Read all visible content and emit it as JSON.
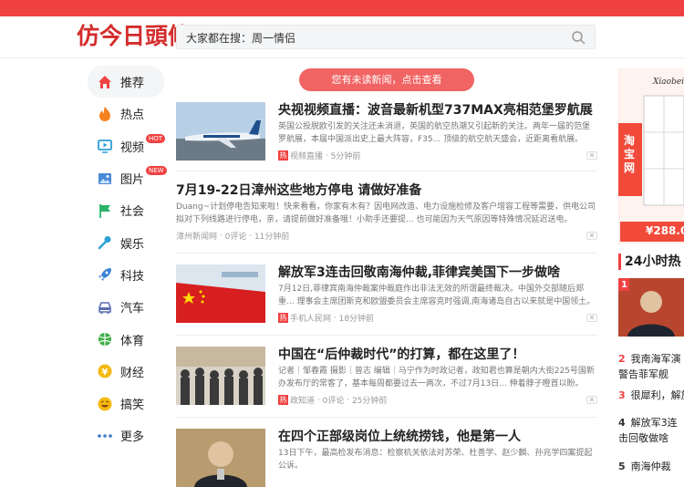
{
  "header": {
    "logo": "仿今日頭條",
    "search": {
      "placeholder": "大家都在搜：周一情侣",
      "value": "大家都在搜：周一情侣"
    }
  },
  "sidebar": {
    "items": [
      {
        "label": "推荐",
        "icon": "home-icon",
        "badge": ""
      },
      {
        "label": "热点",
        "icon": "flame-icon",
        "badge": ""
      },
      {
        "label": "视频",
        "icon": "video-icon",
        "badge": "HOT"
      },
      {
        "label": "图片",
        "icon": "image-icon",
        "badge": "NEW"
      },
      {
        "label": "社会",
        "icon": "flag-icon",
        "badge": ""
      },
      {
        "label": "娱乐",
        "icon": "microphone-icon",
        "badge": ""
      },
      {
        "label": "科技",
        "icon": "rocket-icon",
        "badge": ""
      },
      {
        "label": "汽车",
        "icon": "car-icon",
        "badge": ""
      },
      {
        "label": "体育",
        "icon": "ball-icon",
        "badge": ""
      },
      {
        "label": "财经",
        "icon": "yen-icon",
        "badge": ""
      },
      {
        "label": "搞笑",
        "icon": "smile-icon",
        "badge": ""
      },
      {
        "label": "更多",
        "icon": "more-icon",
        "badge": ""
      }
    ]
  },
  "notice": "您有未读新闻，点击查看",
  "feed": [
    {
      "title": "央视视频直播：波音最新机型737MAX亮相范堡罗航展",
      "abstract": "英国公投脱欧引发的关注还未消退，英国的航空热潮又引起新的关注。两年一届的范堡罗航展，本届中国派出史上最大阵容，F35... 顶级的航空航天盛会，近距离看航展。",
      "hot": "热",
      "source": "视频直播",
      "comments": "",
      "time": "5分钟前",
      "thumb": "airplane"
    },
    {
      "title": "7月19-22日漳州这些地方停电 请做好准备",
      "abstract": "Duang~计划停电告知来啦！快来看看，你家有木有？因电网改造、电力设施检修及客户增容工程等需要，供电公司拟对下列线路进行停电，亲，请提前做好准备哦！小助手还要提... 也可能因为天气原因等特殊情况延迟送电。",
      "hot": "",
      "source": "漳州新闻网",
      "comments": "0评论",
      "time": "11分钟前",
      "thumb": ""
    },
    {
      "title": "解放军3连击回敬南海仲裁,菲律宾美国下一步做啥",
      "abstract": "7月12日,菲律宾南海仲裁案仲裁庭作出非法无效的所谓最终裁决。中国外交部随后郑重... 理事会主席团斯克和欧盟委员会主席容克时强调,南海诸岛自古以来就是中国领土。",
      "hot": "热",
      "source": "手机人民网",
      "comments": "",
      "time": "18分钟前",
      "thumb": "flag"
    },
    {
      "title": "中国在“后仲裁时代”的打算，都在这里了！",
      "abstract": "记者｜邹春霞 摄影｜曾志 编辑｜马宁作为时政记者，政知君也算是朝内大街225号国新办发布厅的常客了，基本每周都要过去一两次，不过7月13日... 伸着脖子瞪首以盼。",
      "hot": "热",
      "source": "政知道",
      "comments": "0评论",
      "time": "25分钟前",
      "thumb": "crowd"
    },
    {
      "title": "在四个正部级岗位上统统捞钱，他是第一人",
      "abstract": "13日下午，最高检发布消息：检察机关依法对苏荣、杜善学、赵少麟、孙兆学四案提起公诉。",
      "hot": "",
      "source": "",
      "comments": "",
      "time": "",
      "thumb": "portrait"
    }
  ],
  "right": {
    "ad_brand": "Xiaobei",
    "ad_text": "淘宝网",
    "ad_price": "¥288.0",
    "hot_title": "24小时热",
    "hot_items": [
      {
        "num": "1",
        "text": ""
      },
      {
        "num": "2",
        "text": "我南海军演警告菲军舰"
      },
      {
        "num": "3",
        "text": "很犀利，解放"
      },
      {
        "num": "4",
        "text": "解放军3连击回敬做啥"
      },
      {
        "num": "5",
        "text": "南海仲裁"
      }
    ]
  },
  "colors": {
    "brand": "#f04142",
    "notice": "#f06463",
    "logo": "#d42c2c"
  }
}
